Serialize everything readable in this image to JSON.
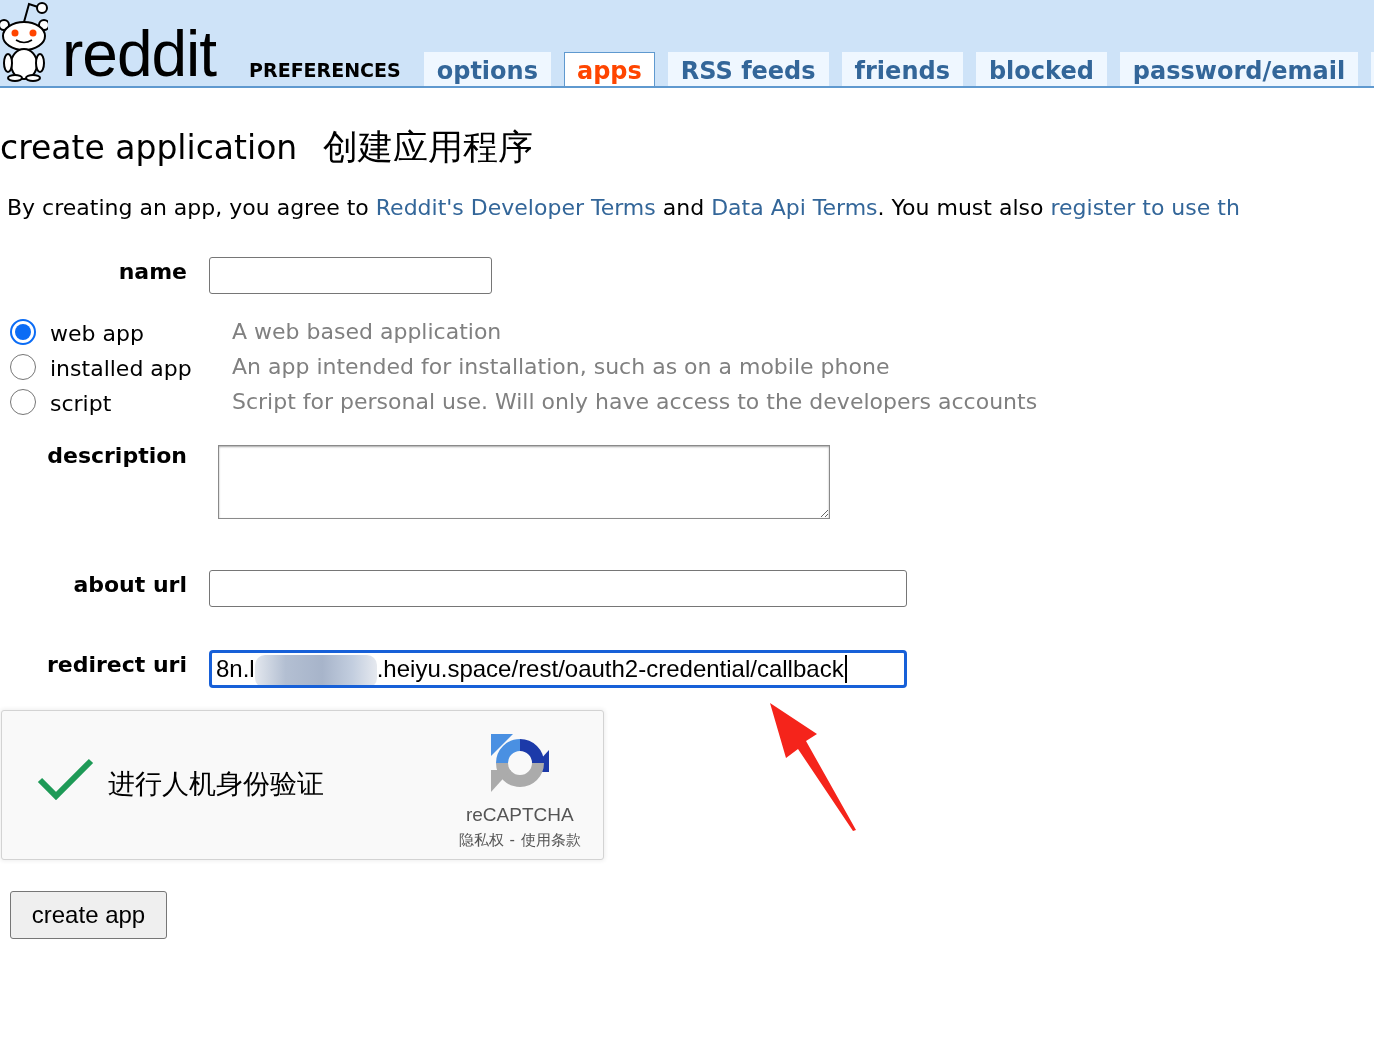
{
  "header": {
    "logo_text": "reddit",
    "section_title": "PREFERENCES",
    "tabs": [
      {
        "label": "options",
        "selected": false
      },
      {
        "label": "apps",
        "selected": true
      },
      {
        "label": "RSS feeds",
        "selected": false
      },
      {
        "label": "friends",
        "selected": false
      },
      {
        "label": "blocked",
        "selected": false
      },
      {
        "label": "password/email",
        "selected": false
      }
    ]
  },
  "page_title": "create application",
  "page_title_translation": "创建应用程序",
  "notice": [
    {
      "kind": "text",
      "text": "By creating an app, you agree to "
    },
    {
      "kind": "link",
      "text": "Reddit's Developer Terms"
    },
    {
      "kind": "text",
      "text": " and "
    },
    {
      "kind": "link",
      "text": "Data Api Terms"
    },
    {
      "kind": "text",
      "text": ". You must also "
    },
    {
      "kind": "link",
      "text": "register to use th"
    }
  ],
  "form": {
    "name_field": {
      "label": "name"
    },
    "app_types": [
      {
        "label": "web app",
        "description": "A web based application",
        "selected": true
      },
      {
        "label": "installed app",
        "description": "An app intended for installation, such as on a mobile phone",
        "selected": false
      },
      {
        "label": "script",
        "description": "Script for personal use. Will only have access to the developers accounts",
        "selected": false
      }
    ],
    "description_field": {
      "label": "description"
    },
    "about_url_field": {
      "label": "about url"
    },
    "redirect_uri_field": {
      "label": "redirect uri",
      "value_parts": [
        "8n.l",
        ".heiyu.space/rest/oauth2-credential/callback"
      ],
      "focused": true
    }
  },
  "captcha": {
    "checked": true,
    "label": "进行人机身份验证",
    "brand": "reCAPTCHA",
    "privacy_link": "隐私权",
    "separator": "-",
    "terms_link": "使用条款"
  },
  "submit_button": "create app"
}
